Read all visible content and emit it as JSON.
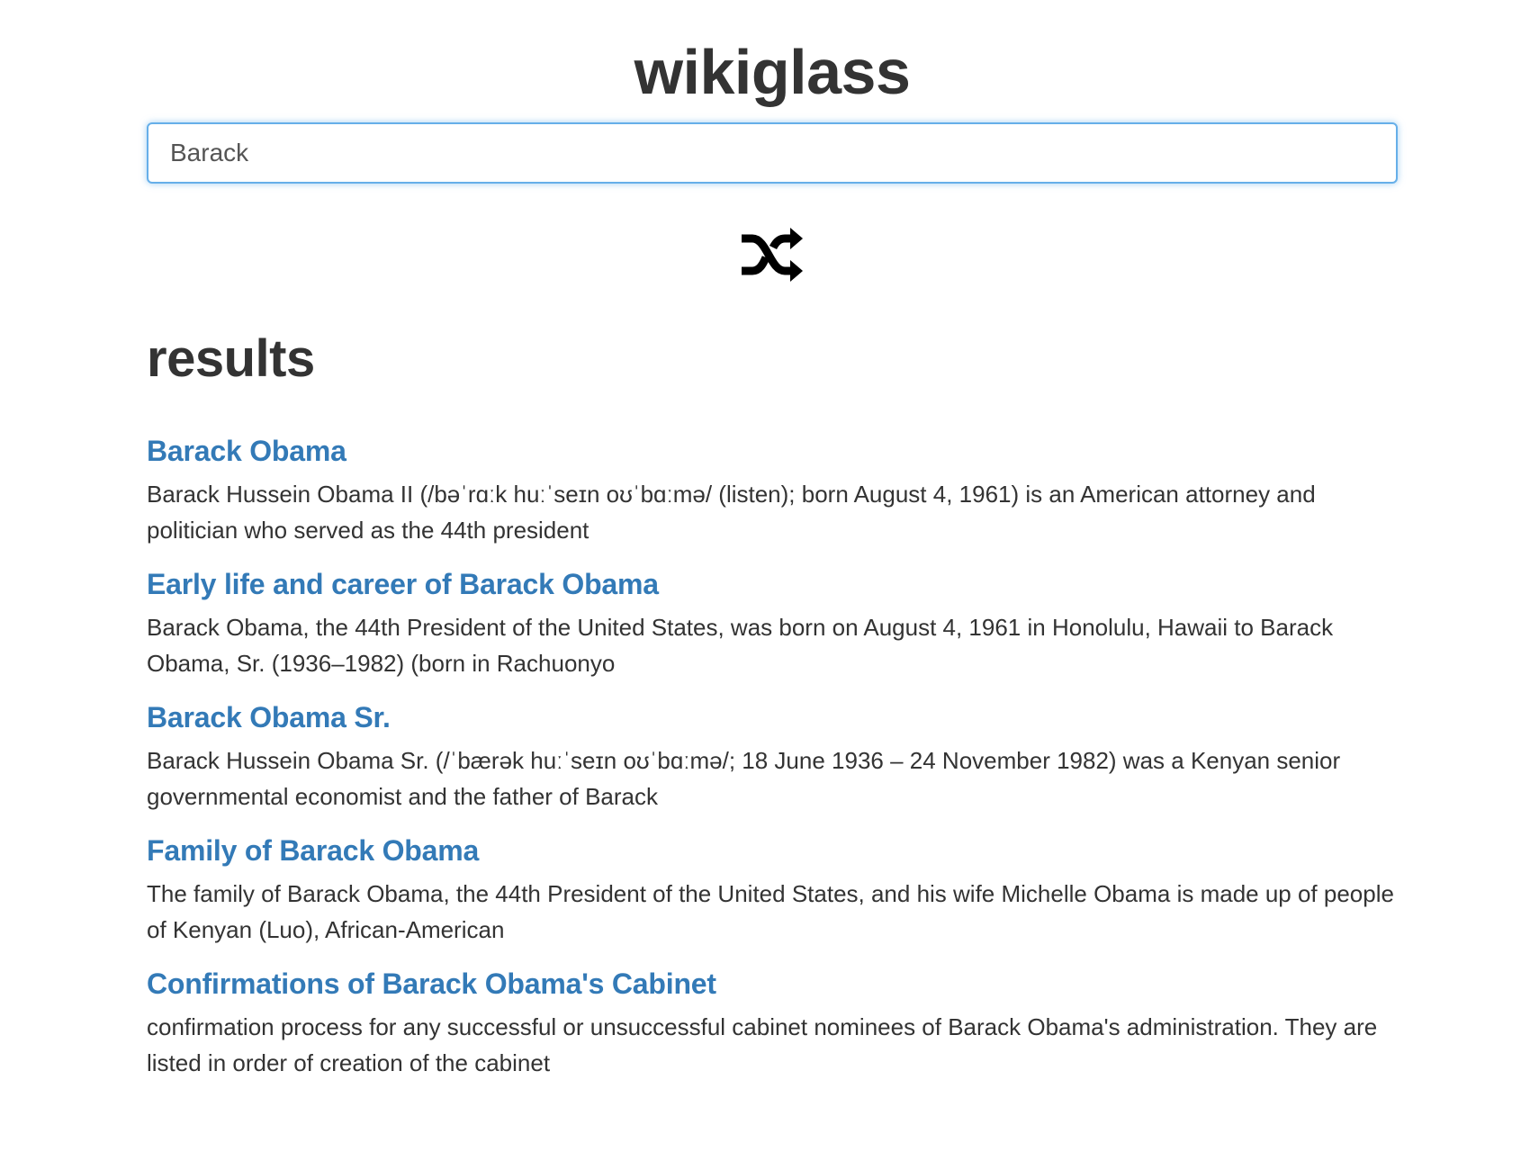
{
  "app": {
    "title": "wikiglass"
  },
  "search": {
    "value": "Barack ",
    "placeholder": ""
  },
  "shuffle": {
    "icon": "shuffle-icon"
  },
  "results": {
    "heading": "results",
    "items": [
      {
        "title": "Barack Obama",
        "snippet": "Barack Hussein Obama II (/bəˈrɑːk huːˈseɪn oʊˈbɑːmə/ (listen); born August 4, 1961) is an American attorney and politician who served as the 44th president"
      },
      {
        "title": "Early life and career of Barack Obama",
        "snippet": "Barack Obama, the 44th President of the United States, was born on August 4, 1961 in Honolulu, Hawaii to Barack Obama, Sr. (1936–1982) (born in Rachuonyo"
      },
      {
        "title": "Barack Obama Sr.",
        "snippet": "Barack Hussein Obama Sr. (/ˈbærək huːˈseɪn oʊˈbɑːmə/; 18 June 1936 – 24 November 1982) was a Kenyan senior governmental economist and the father of Barack"
      },
      {
        "title": "Family of Barack Obama",
        "snippet": "The family of Barack Obama, the 44th President of the United States, and his wife Michelle Obama is made up of people of Kenyan (Luo), African-American"
      },
      {
        "title": "Confirmations of Barack Obama's Cabinet",
        "snippet": "confirmation process for any successful or unsuccessful cabinet nominees of Barack Obama's administration. They are listed in order of creation of the cabinet"
      }
    ]
  },
  "colors": {
    "link": "#337ab7",
    "text": "#333333",
    "focus_border": "#66afe9"
  }
}
